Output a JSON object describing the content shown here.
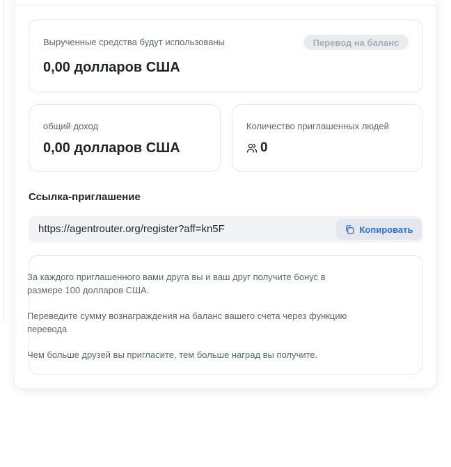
{
  "balance": {
    "label": "Вырученные средства будут использованы",
    "value": "0,00 долларов США",
    "transfer_button": "Перевод на баланс"
  },
  "income": {
    "label": "общий доход",
    "value": "0,00 долларов США"
  },
  "invited": {
    "label": "Количество приглашенных людей",
    "icon": "users-icon",
    "value": "0"
  },
  "invite_link": {
    "title": "Ссылка-приглашение",
    "url": "https://agentrouter.org/register?aff=kn5F",
    "copy_button": "Копировать",
    "copy_icon": "copy-icon"
  },
  "info": {
    "lines": [
      "За каждого приглашенного вами друга вы и ваш друг получите бонус в размере 100 долларов США.",
      "Переведите сумму вознаграждения на баланс вашего счета через функцию перевода",
      "Чем больше друзей вы пригласите, тем больше наград вы получите."
    ]
  },
  "colors": {
    "accent": "#2a6fd6",
    "muted_text": "#5f6670",
    "card_border": "#e6e8ec",
    "link_bg": "#f2f3f5"
  }
}
